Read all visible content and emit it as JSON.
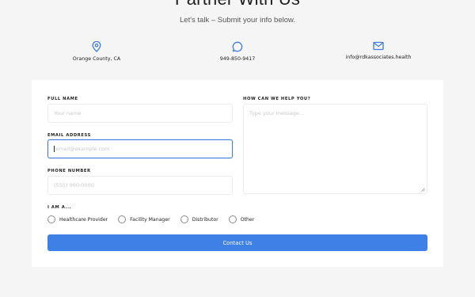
{
  "header": {
    "title": "Partner With Us",
    "subtitle": "Let's talk – Submit your info below."
  },
  "contacts": [
    {
      "icon": "location-pin-icon",
      "text": "Orange County, CA"
    },
    {
      "icon": "chat-bubble-icon",
      "text": "949-850-9417"
    },
    {
      "icon": "envelope-icon",
      "text": "info@rdkassociates.health"
    }
  ],
  "form": {
    "full_name": {
      "label": "FULL NAME",
      "placeholder": "Your name"
    },
    "email": {
      "label": "EMAIL ADDRESS",
      "placeholder": "email@example.com"
    },
    "phone": {
      "label": "PHONE NUMBER",
      "placeholder": "(555) 000-0000"
    },
    "message": {
      "label": "HOW CAN WE HELP YOU?",
      "placeholder": "Type your message..."
    },
    "role": {
      "label": "I AM A...",
      "options": [
        "Healthcare Provider",
        "Facility Manager",
        "Distributor",
        "Other"
      ]
    },
    "submit_label": "Contact Us"
  },
  "colors": {
    "accent": "#3f80e6",
    "background": "#f4f5f4",
    "card": "#ffffff"
  }
}
